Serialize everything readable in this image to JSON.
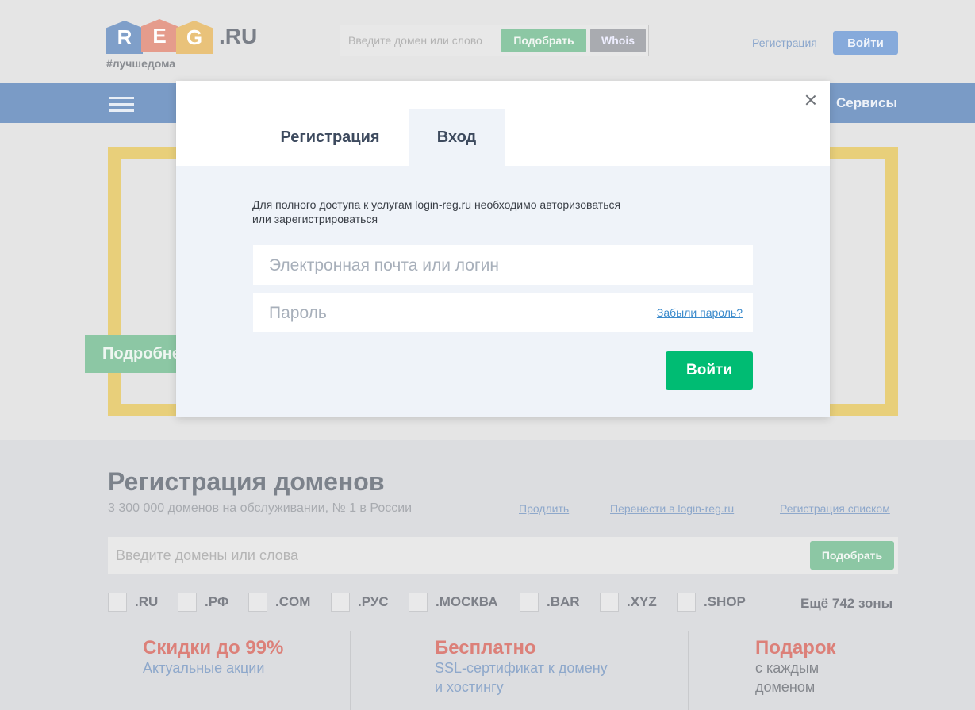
{
  "header": {
    "logo_letters": [
      "R",
      "E",
      "G"
    ],
    "logo_suffix": ".RU",
    "logo_tag": "#лучшедома",
    "search_placeholder": "Введите домен или слово",
    "pick_label": "Подобрать",
    "whois_label": "Whois",
    "register_link": "Регистрация",
    "login_button": "Войти"
  },
  "navbar": {
    "services_label": "Сервисы"
  },
  "hero": {
    "more_button": "Подробнее"
  },
  "domains": {
    "title": "Регистрация доменов",
    "subtitle": "3 300 000 доменов на обслуживании, № 1 в России",
    "links": [
      "Продлить",
      "Перенести в login-reg.ru",
      "Регистрация списком"
    ],
    "search_placeholder": "Введите домены или слова",
    "pick_label": "Подобрать",
    "zones": [
      ".RU",
      ".РФ",
      ".COM",
      ".РУС",
      ".МОСКВА",
      ".BAR",
      ".XYZ",
      ".SHOP"
    ],
    "more_zones": "Ещё 742 зоны"
  },
  "promos": [
    {
      "title": "Скидки до 99%",
      "line1": "Актуальные акции",
      "line2": ""
    },
    {
      "title": "Бесплатно",
      "line1": "SSL-сертификат к домену",
      "line2": "и хостингу"
    },
    {
      "title": "Подарок",
      "line1": "с каждым",
      "line2": "доменом"
    }
  ],
  "modal": {
    "tabs": {
      "register": "Регистрация",
      "login": "Вход"
    },
    "active_tab": "login",
    "info_line1": "Для полного доступа к услугам login-reg.ru необходимо авторизоваться",
    "info_line2": "или зарегистрироваться",
    "email_placeholder": "Электронная почта или логин",
    "password_placeholder": "Пароль",
    "forgot_link": "Забыли пароль?",
    "submit_label": "Войти"
  },
  "colors": {
    "accent_green": "#00bc73",
    "link_blue": "#3c8bcc",
    "nav_blue": "#7a9bc6",
    "promo_red": "#dc8079",
    "frame_yellow": "#e8cf7a"
  }
}
